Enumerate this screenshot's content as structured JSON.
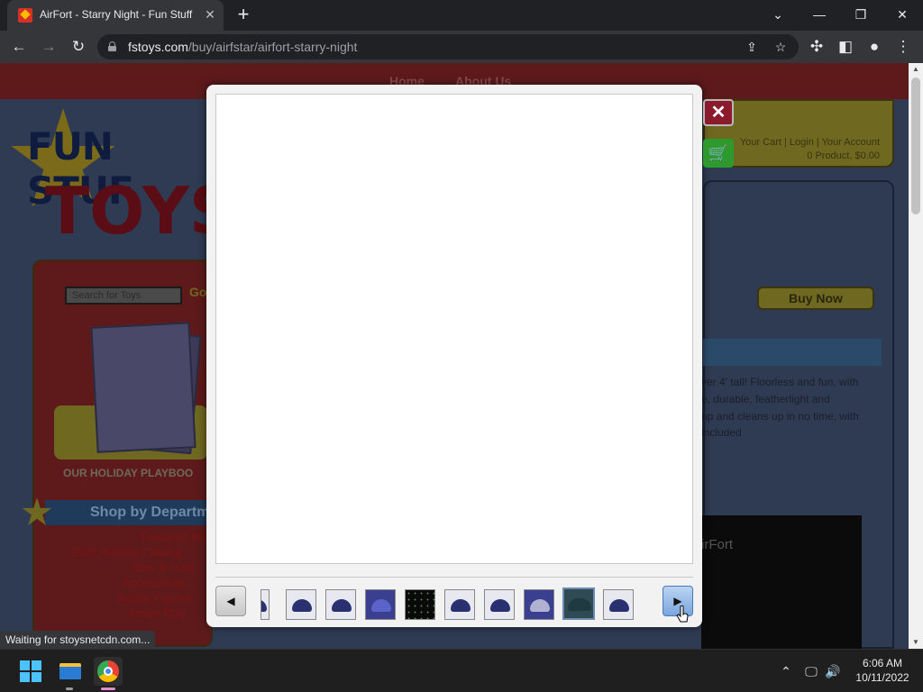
{
  "browser": {
    "tab_title": "AirFort - Starry Night - Fun Stuff",
    "tab_close": "✕",
    "new_tab": "+",
    "url_host": "fstoys.com",
    "url_path": "/buy/airfstar/airfort-starry-night",
    "status_text": "Waiting for stoysnetcdn.com..."
  },
  "site": {
    "nav_links": [
      "Home",
      "About Us"
    ],
    "logo_line1": "FUN STUF",
    "logo_line2": "TOYS",
    "search_placeholder": "Search for Toys",
    "search_go": "Go",
    "playbook_caption": "OUR HOLIDAY PLAYBOO",
    "dept_heading": "Shop by Departm",
    "dept_items": [
      "Featured Items",
      "2022 Holiday Catalog",
      "New & Cool",
      "Accessories",
      "Action Figures",
      "Active Play"
    ],
    "cart_links": "Your Cart | Login | Your Account",
    "cart_count": "0 Product, $0.00",
    "buy_now": "Buy Now",
    "description": [
      "ver 4' tall! Floorless and fun, with",
      "e, durable, featherlight and",
      "up and cleans up in no time, with",
      "included"
    ],
    "video_title": "irFort"
  },
  "lightbox": {
    "close_label": "✕",
    "prev_label": "◀",
    "next_label": "▶",
    "thumbnail_count": 10,
    "active_thumbnail": 9
  },
  "taskbar": {
    "time": "6:06 AM",
    "date": "10/11/2022"
  }
}
